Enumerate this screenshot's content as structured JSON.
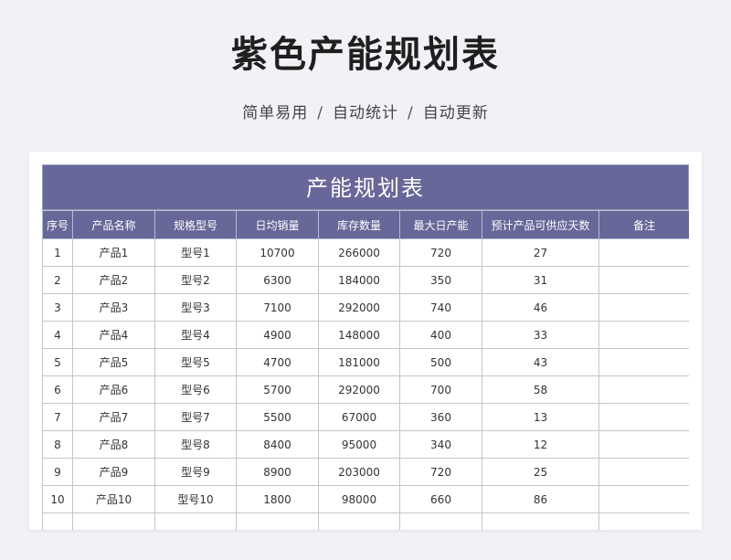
{
  "page": {
    "title": "紫色产能规划表",
    "features": [
      "简单易用",
      "自动统计",
      "自动更新"
    ],
    "separator": "/"
  },
  "sheet": {
    "title": "产能规划表",
    "header_color": "#676799",
    "columns": [
      "序号",
      "产品名称",
      "规格型号",
      "日均销量",
      "库存数量",
      "最大日产能",
      "预计产品可供应天数",
      "备注"
    ],
    "rows": [
      [
        "1",
        "产品1",
        "型号1",
        "10700",
        "266000",
        "720",
        "27",
        ""
      ],
      [
        "2",
        "产品2",
        "型号2",
        "6300",
        "184000",
        "350",
        "31",
        ""
      ],
      [
        "3",
        "产品3",
        "型号3",
        "7100",
        "292000",
        "740",
        "46",
        ""
      ],
      [
        "4",
        "产品4",
        "型号4",
        "4900",
        "148000",
        "400",
        "33",
        ""
      ],
      [
        "5",
        "产品5",
        "型号5",
        "4700",
        "181000",
        "500",
        "43",
        ""
      ],
      [
        "6",
        "产品6",
        "型号6",
        "5700",
        "292000",
        "700",
        "58",
        ""
      ],
      [
        "7",
        "产品7",
        "型号7",
        "5500",
        "67000",
        "360",
        "13",
        ""
      ],
      [
        "8",
        "产品8",
        "型号8",
        "8400",
        "95000",
        "340",
        "12",
        ""
      ],
      [
        "9",
        "产品9",
        "型号9",
        "8900",
        "203000",
        "720",
        "25",
        ""
      ],
      [
        "10",
        "产品10",
        "型号10",
        "1800",
        "98000",
        "660",
        "86",
        ""
      ],
      [
        "",
        "",
        "",
        "",
        "",
        "",
        "",
        ""
      ]
    ]
  }
}
